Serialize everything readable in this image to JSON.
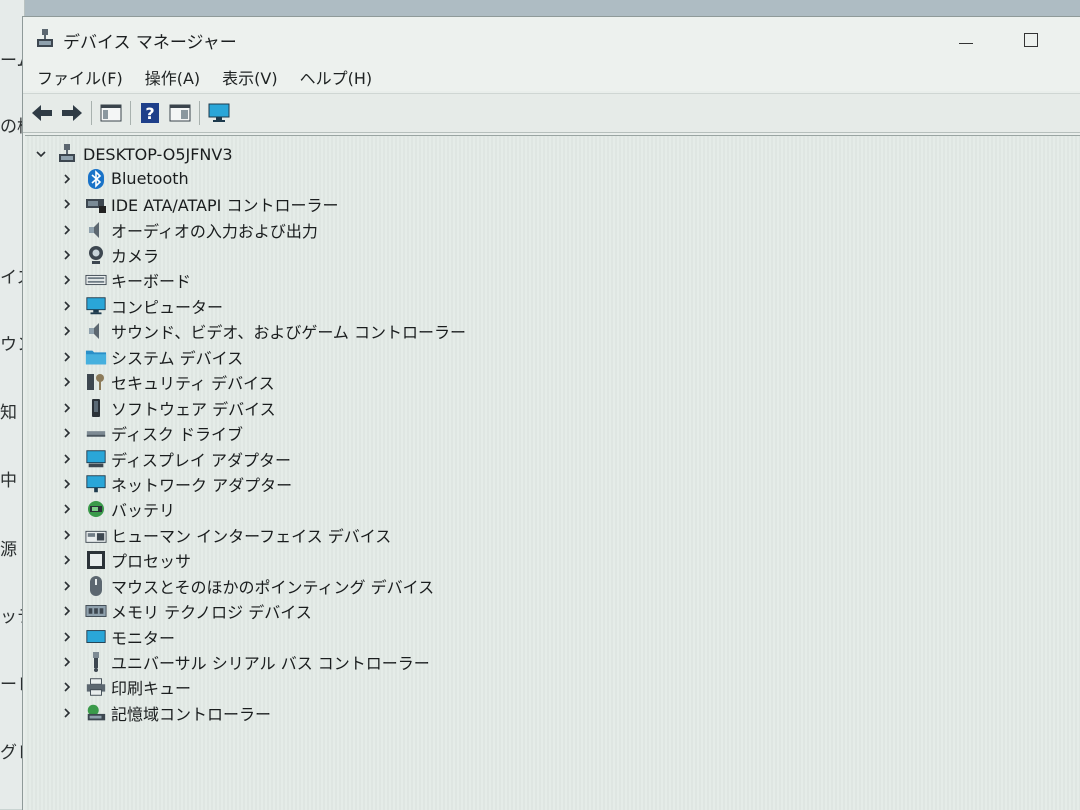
{
  "background_fragments": [
    "ーム",
    "の検",
    "イス",
    "ウン",
    "知",
    "中",
    "源",
    "ッテ",
    "ーレ",
    "グレ"
  ],
  "window": {
    "title": "デバイス マネージャー"
  },
  "menu": {
    "items": [
      "ファイル(F)",
      "操作(A)",
      "表示(V)",
      "ヘルプ(H)"
    ]
  },
  "tree": {
    "root": "DESKTOP-O5JFNV3",
    "items": [
      {
        "label": "Bluetooth",
        "icon": "bluetooth-icon"
      },
      {
        "label": "IDE ATA/ATAPI コントローラー",
        "icon": "ide-controller-icon"
      },
      {
        "label": "オーディオの入力および出力",
        "icon": "speaker-icon"
      },
      {
        "label": "カメラ",
        "icon": "camera-icon"
      },
      {
        "label": "キーボード",
        "icon": "keyboard-icon"
      },
      {
        "label": "コンピューター",
        "icon": "computer-icon"
      },
      {
        "label": "サウンド、ビデオ、およびゲーム コントローラー",
        "icon": "sound-icon"
      },
      {
        "label": "システム デバイス",
        "icon": "system-folder-icon"
      },
      {
        "label": "セキュリティ デバイス",
        "icon": "security-key-icon"
      },
      {
        "label": "ソフトウェア デバイス",
        "icon": "software-device-icon"
      },
      {
        "label": "ディスク ドライブ",
        "icon": "disk-drive-icon"
      },
      {
        "label": "ディスプレイ アダプター",
        "icon": "display-adapter-icon"
      },
      {
        "label": "ネットワーク アダプター",
        "icon": "network-adapter-icon"
      },
      {
        "label": "バッテリ",
        "icon": "battery-icon"
      },
      {
        "label": "ヒューマン インターフェイス デバイス",
        "icon": "hid-icon"
      },
      {
        "label": "プロセッサ",
        "icon": "processor-icon"
      },
      {
        "label": "マウスとそのほかのポインティング デバイス",
        "icon": "mouse-icon"
      },
      {
        "label": "メモリ テクノロジ デバイス",
        "icon": "memory-icon"
      },
      {
        "label": "モニター",
        "icon": "monitor-icon"
      },
      {
        "label": "ユニバーサル シリアル バス コントローラー",
        "icon": "usb-icon"
      },
      {
        "label": "印刷キュー",
        "icon": "printer-icon"
      },
      {
        "label": "記憶域コントローラー",
        "icon": "storage-controller-icon"
      }
    ]
  },
  "colors": {
    "window_bg": "#e9eeeb",
    "accent_blue": "#1a73c8",
    "icon_cyan": "#2aa6d8"
  }
}
